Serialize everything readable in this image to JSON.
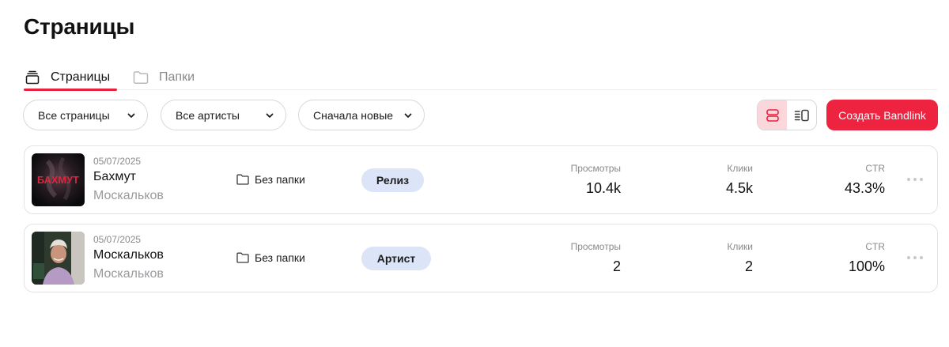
{
  "page": {
    "title": "Страницы"
  },
  "tabs": [
    {
      "label": "Страницы",
      "icon": "stack-icon",
      "active": true
    },
    {
      "label": "Папки",
      "icon": "folder-icon",
      "active": false
    }
  ],
  "filters": [
    {
      "label": "Все страницы"
    },
    {
      "label": "Все артисты"
    },
    {
      "label": "Сначала новые"
    }
  ],
  "view_toggle": {
    "active": "cards-view",
    "options": [
      "cards-view-icon",
      "list-view-icon"
    ]
  },
  "create_button": {
    "label": "Создать Bandlink"
  },
  "colors": {
    "accent": "#ee2340",
    "badge_bg": "#dbe5f7",
    "toggle_active_bg": "#fbd6db"
  },
  "rows": [
    {
      "date": "05/07/2025",
      "name": "Бахмут",
      "artist": "Москальков",
      "cover_text": "БАХМУТ",
      "folder": "Без папки",
      "type": "Релиз",
      "views_label": "Просмотры",
      "views": "10.4k",
      "clicks_label": "Клики",
      "clicks": "4.5k",
      "ctr_label": "CTR",
      "ctr": "43.3%"
    },
    {
      "date": "05/07/2025",
      "name": "Москальков",
      "artist": "Москальков",
      "folder": "Без папки",
      "type": "Артист",
      "views_label": "Просмотры",
      "views": "2",
      "clicks_label": "Клики",
      "clicks": "2",
      "ctr_label": "CTR",
      "ctr": "100%"
    }
  ]
}
